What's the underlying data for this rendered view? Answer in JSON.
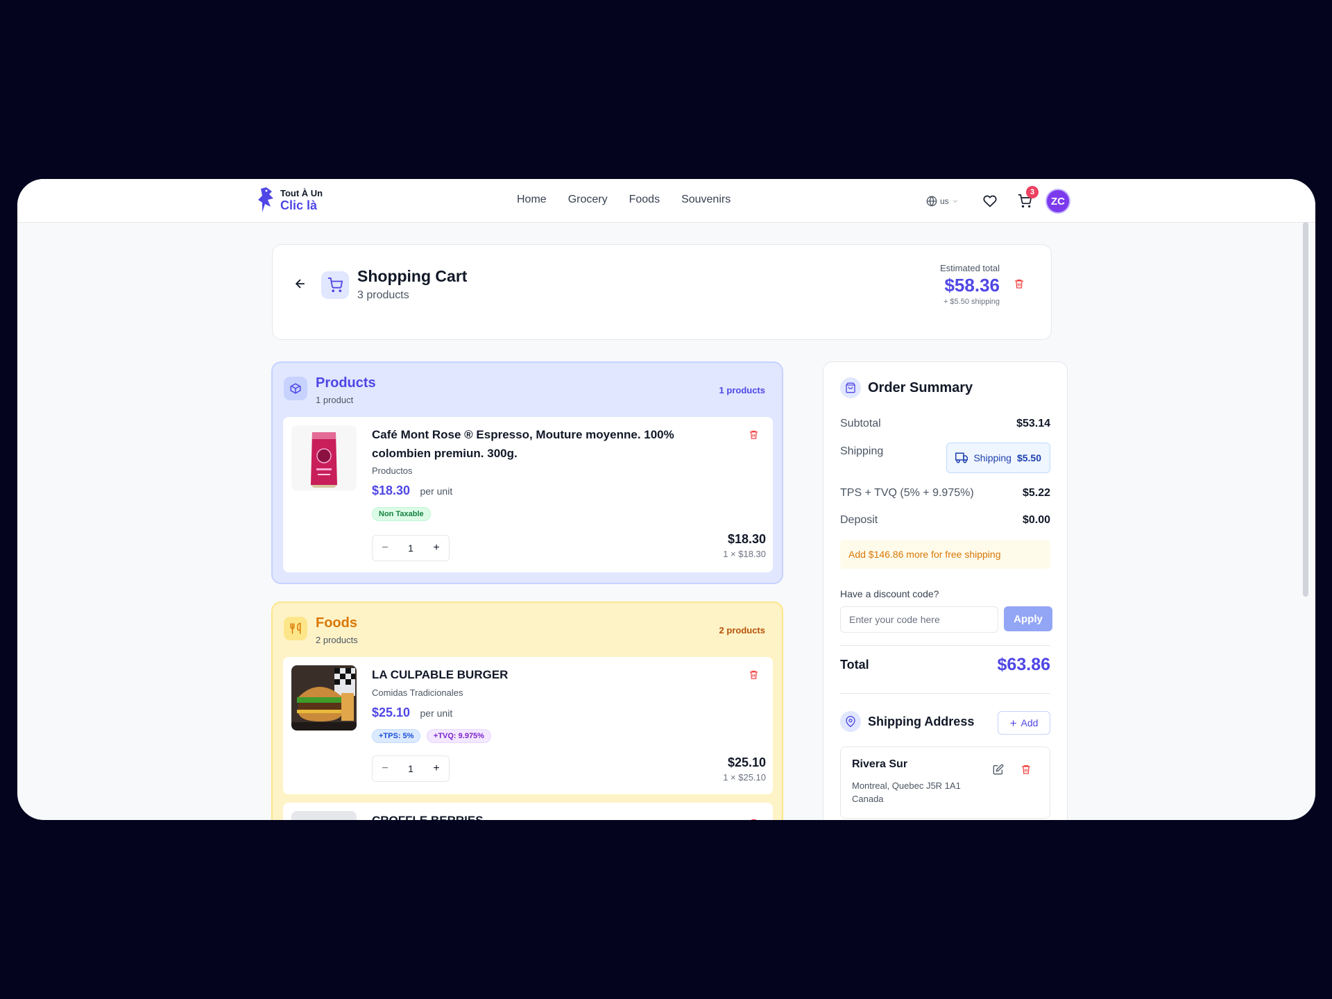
{
  "brand": {
    "line1": "Tout À Un",
    "line2": "Clic là"
  },
  "nav": {
    "links": [
      "Home",
      "Grocery",
      "Foods",
      "Souvenirs"
    ],
    "language": "us",
    "cart_count": "3",
    "avatar_initials": "ZC"
  },
  "header": {
    "title": "Shopping Cart",
    "subtitle": "3 products",
    "estimated_label": "Estimated total",
    "estimated_value": "$58.36",
    "shipping_note": "+ $5.50 shipping"
  },
  "products_section": {
    "title": "Products",
    "subtitle": "1 product",
    "count": "1 products",
    "items": [
      {
        "name": "Café Mont Rose ® Espresso, Mouture moyenne. 100% colombien premiun. 300g.",
        "category": "Productos",
        "price": "$18.30",
        "unit": "per unit",
        "tags": [
          "Non Taxable"
        ],
        "qty": "1",
        "line_total": "$18.30",
        "line_detail": "1 × $18.30"
      }
    ]
  },
  "foods_section": {
    "title": "Foods",
    "subtitle": "2 products",
    "count": "2 products",
    "items": [
      {
        "name": "LA CULPABLE BURGER",
        "category": "Comidas Tradicionales",
        "price": "$25.10",
        "unit": "per unit",
        "tags": [
          "+TPS: 5%",
          "+TVQ: 9.975%"
        ],
        "qty": "1",
        "line_total": "$25.10",
        "line_detail": "1 × $25.10"
      },
      {
        "name": "CROFFLE BERRIES"
      }
    ]
  },
  "summary": {
    "title": "Order Summary",
    "subtotal_label": "Subtotal",
    "subtotal_value": "$53.14",
    "shipping_label": "Shipping",
    "shipping_chip_label": "Shipping",
    "shipping_chip_value": "$5.50",
    "tax_label": "TPS + TVQ (5% + 9.975%)",
    "tax_value": "$5.22",
    "deposit_label": "Deposit",
    "deposit_value": "$0.00",
    "free_shipping_note": "Add $146.86 more for free shipping",
    "discount_label": "Have a discount code?",
    "discount_placeholder": "Enter your code here",
    "apply_label": "Apply",
    "total_label": "Total",
    "total_value": "$63.86"
  },
  "address": {
    "title": "Shipping Address",
    "add_label": "Add",
    "name": "Rivera Sur",
    "line1": "Montreal, Quebec J5R 1A1",
    "line2": "Canada"
  },
  "colors": {
    "accent": "#4f46e5",
    "danger": "#ef4444",
    "foods_accent": "#d97706",
    "background": "#04041f"
  }
}
